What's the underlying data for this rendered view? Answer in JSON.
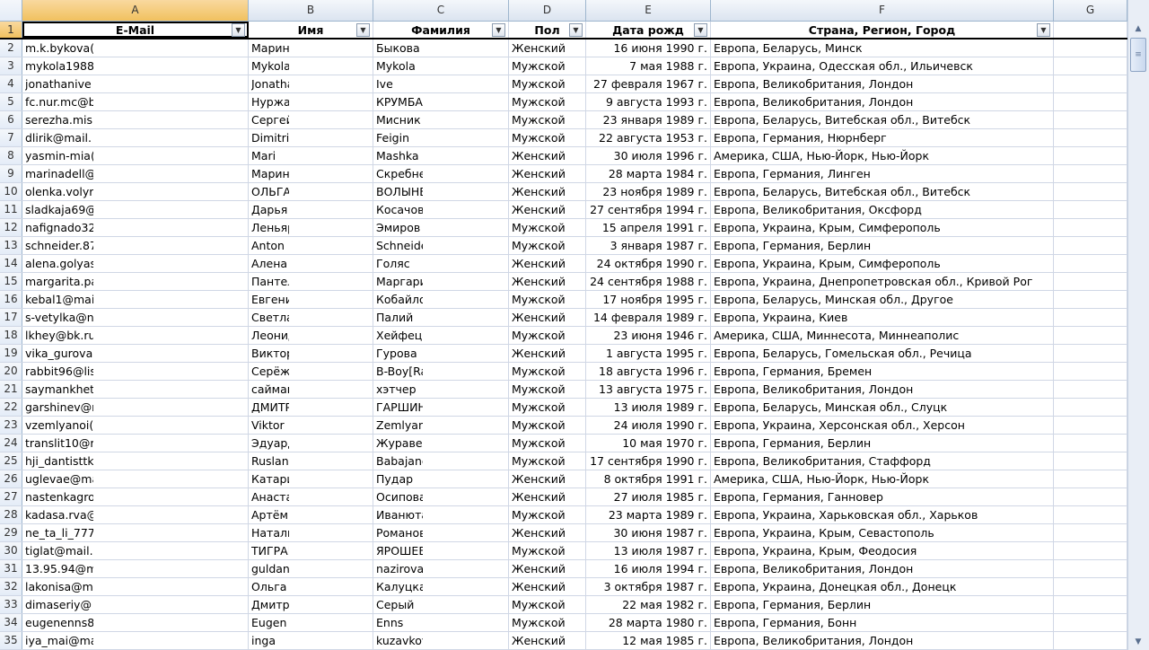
{
  "columns": [
    "A",
    "B",
    "C",
    "D",
    "E",
    "F",
    "G"
  ],
  "headers": [
    "E-Mail",
    "Имя",
    "Фамилия",
    "Пол",
    "Дата рожд",
    "Страна, Регион, Город"
  ],
  "rows": [
    [
      "m.k.bykova(",
      "Марин",
      "Быкова",
      "Женский",
      "16 июня 1990 г.",
      "Европа, Беларусь, Минск"
    ],
    [
      "mykola1988",
      "Mykola",
      "Mykola",
      "Мужской",
      "7 мая 1988 г.",
      "Европа, Украина, Одесская обл., Ильичевск"
    ],
    [
      "jonathanive",
      "Jonatha",
      "Ive",
      "Мужской",
      "27 февраля 1967 г.",
      "Европа, Великобритания, Лондон"
    ],
    [
      "fc.nur.mc@b",
      "Нуржак",
      "КРУМБА",
      "Мужской",
      "9 августа 1993 г.",
      "Европа, Великобритания, Лондон"
    ],
    [
      "serezha.mis",
      "Сергей",
      "Мисник",
      "Мужской",
      "23 января 1989 г.",
      "Европа, Беларусь, Витебская обл., Витебск"
    ],
    [
      "dlirik@mail.",
      "Dimitri",
      "Feigin",
      "Мужской",
      "22 августа 1953 г.",
      "Европа, Германия, Нюрнберг"
    ],
    [
      "yasmin-mia(",
      "Mari",
      "Mashka",
      "Женский",
      "30 июля 1996 г.",
      "Америка, США, Нью-Йорк, Нью-Йорк"
    ],
    [
      "marinadell@",
      "Марин",
      "Скребне",
      "Женский",
      "28 марта 1984 г.",
      "Европа, Германия, Линген"
    ],
    [
      "olenka.volyr",
      "ОЛЬГА",
      "ВОЛЫНЕ",
      "Женский",
      "23 ноября 1989 г.",
      "Европа, Беларусь, Витебская обл., Витебск"
    ],
    [
      "sladkaja69@",
      "Дарья",
      "Косачов",
      "Женский",
      "27 сентября 1994 г.",
      "Европа, Великобритания, Оксфорд"
    ],
    [
      "nafignado32",
      "Леньяр",
      "Эмиров",
      "Мужской",
      "15 апреля 1991 г.",
      "Европа, Украина, Крым, Симферополь"
    ],
    [
      "schneider.87",
      "Anton",
      "Schneide",
      "Мужской",
      "3 января 1987 г.",
      "Европа, Германия, Берлин"
    ],
    [
      "alena.golyas",
      "Алена",
      "Голяс",
      "Женский",
      "24 октября 1990 г.",
      "Европа, Украина, Крым, Симферополь"
    ],
    [
      "margarita.pa",
      "Пантел",
      "Маргари",
      "Женский",
      "24 сентября 1988 г.",
      "Европа, Украина, Днепропетровская обл., Кривой Рог"
    ],
    [
      "kebal1@mai",
      "Евгени",
      "Кобайло",
      "Мужской",
      "17 ноября 1995 г.",
      "Европа, Беларусь, Минская обл., Другое"
    ],
    [
      "s-vetylka@n",
      "Светла",
      "Палий",
      "Женский",
      "14 февраля 1989 г.",
      "Европа, Украина, Киев"
    ],
    [
      "lkhey@bk.ru",
      "Леонид",
      "Хейфец",
      "Мужской",
      "23 июня 1946 г.",
      "Америка, США, Миннесота, Миннеаполис"
    ],
    [
      "vika_gurova",
      "Виктор",
      "Гурова",
      "Женский",
      "1 августа 1995 г.",
      "Европа, Беларусь, Гомельская обл., Речица"
    ],
    [
      "rabbit96@lis",
      "Серёжа",
      "B-Boy[Ra",
      "Мужской",
      "18 августа 1996 г.",
      "Европа, Германия, Бремен"
    ],
    [
      "saymankhet",
      "сайман",
      "хэтчер",
      "Мужской",
      "13 августа 1975 г.",
      "Европа, Великобритания, Лондон"
    ],
    [
      "garshinev@r",
      "ДМИТР",
      "ГАРШИН",
      "Мужской",
      "13 июля 1989 г.",
      "Европа, Беларусь, Минская обл., Слуцк"
    ],
    [
      "vzemlyanoi(",
      "Viktor",
      "Zemlyan",
      "Мужской",
      "24 июля 1990 г.",
      "Европа, Украина, Херсонская обл., Херсон"
    ],
    [
      "translit10@r",
      "Эдуард",
      "Журавел",
      "Мужской",
      "10 мая 1970 г.",
      "Европа, Германия, Берлин"
    ],
    [
      "hji_dantisttk",
      "Ruslan",
      "Babajanc",
      "Мужской",
      "17 сентября 1990 г.",
      "Европа, Великобритания, Стаффорд"
    ],
    [
      "uglevae@ma",
      "Катари",
      "Пудар",
      "Женский",
      "8 октября 1991 г.",
      "Америка, США, Нью-Йорк, Нью-Йорк"
    ],
    [
      "nastenkagro",
      "Анаста",
      "Осипова",
      "Женский",
      "27 июля 1985 г.",
      "Европа, Германия, Ганновер"
    ],
    [
      "kadasa.rva@",
      "Артём",
      "Иванюта",
      "Мужской",
      "23 марта 1989 г.",
      "Европа, Украина, Харьковская обл., Харьков"
    ],
    [
      "ne_ta_li_777",
      "Наталь",
      "Романов",
      "Женский",
      "30 июня 1987 г.",
      "Европа, Украина, Крым, Севастополь"
    ],
    [
      "tiglat@mail.",
      "ТИГРАН",
      "ЯРОШЕВ",
      "Мужской",
      "13 июля 1987 г.",
      "Европа, Украина, Крым, Феодосия"
    ],
    [
      "13.95.94@m",
      "guldana",
      "nazirova",
      "Женский",
      "16 июля 1994 г.",
      "Европа, Великобритания, Лондон"
    ],
    [
      "lakonisa@m",
      "Ольга",
      "Калуцка",
      "Женский",
      "3 октября 1987 г.",
      "Европа, Украина, Донецкая обл., Донецк"
    ],
    [
      "dimaseriy@",
      "Дмитри",
      "Серый",
      "Мужской",
      "22 мая 1982 г.",
      "Европа, Германия, Берлин"
    ],
    [
      "eugenenns8",
      "Eugen",
      "Enns",
      "Мужской",
      "28 марта 1980 г.",
      "Европа, Германия, Бонн"
    ],
    [
      "iya_mai@ma",
      "inga",
      "kuzavkov",
      "Женский",
      "12 мая 1985 г.",
      "Европа, Великобритания, Лондон"
    ]
  ],
  "colors": {
    "header_bg": "#dbe4f0",
    "selected_header": "#f1c15f",
    "gridline": "#d0d7e5"
  }
}
